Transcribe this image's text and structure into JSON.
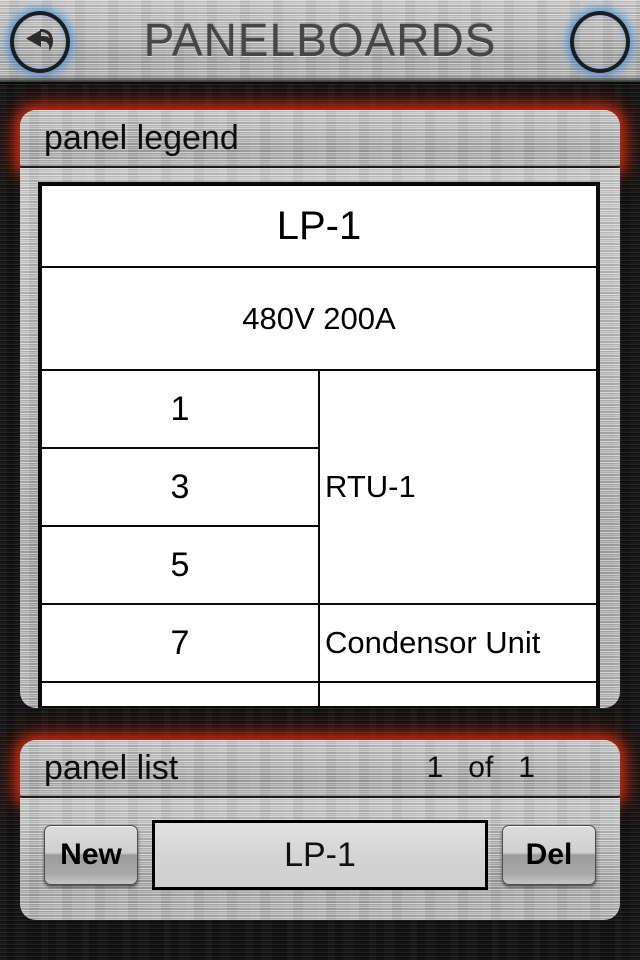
{
  "titlebar": {
    "title": "PANELBOARDS",
    "back_icon": "back-arrow-icon",
    "menu_icon": "hamburger-menu-icon"
  },
  "legend": {
    "header_label": "panel legend",
    "panel_name": "LP-1",
    "panel_rating": "480V 200A",
    "circuits": [
      {
        "numbers": [
          "1",
          "3",
          "5"
        ],
        "description": "RTU-1"
      },
      {
        "numbers": [
          "7"
        ],
        "description": "Condensor Unit"
      },
      {
        "numbers": [
          ""
        ],
        "description": ""
      },
      {
        "numbers": [
          ""
        ],
        "description": ""
      }
    ]
  },
  "panel_list": {
    "header_label": "panel list",
    "count_label": "1   of   1",
    "new_button": "New",
    "delete_button": "Del",
    "selected_panel": "LP-1"
  },
  "colors": {
    "glow_red": "#cd2d12",
    "glow_blue": "#468ce1",
    "metal_light": "#b3b3b3",
    "metal_dark": "#121212"
  }
}
